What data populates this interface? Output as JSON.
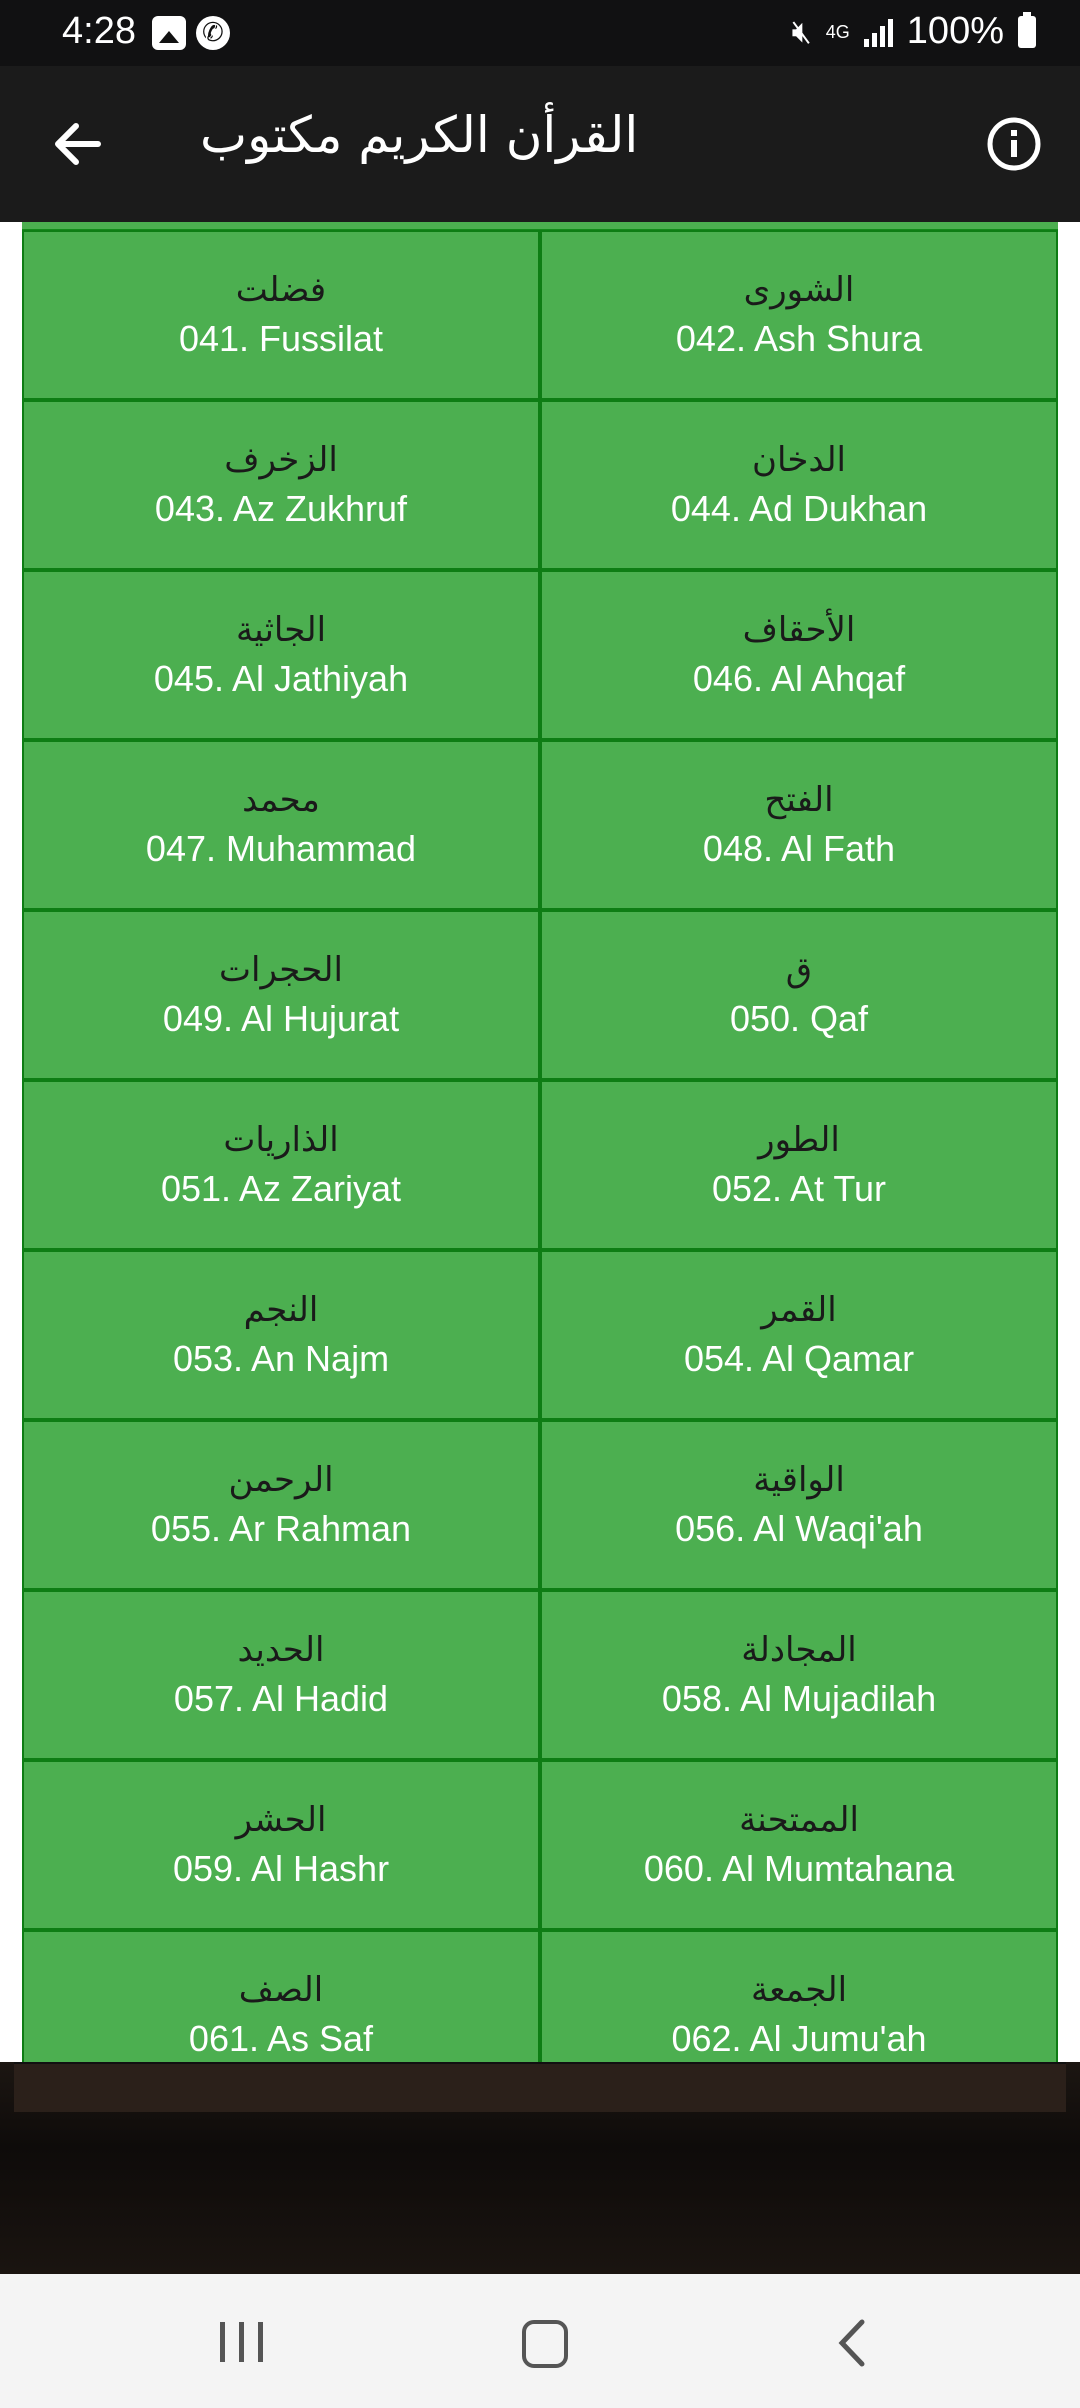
{
  "status_bar": {
    "time": "4:28",
    "network": "4G",
    "battery": "100%"
  },
  "app_bar": {
    "title": "القرأن الكريم مكتوب",
    "back_icon": "arrow-left-icon",
    "info_icon": "info-icon"
  },
  "surahs": [
    {
      "ar": "فضلت",
      "en": "041. Fussilat"
    },
    {
      "ar": "الشورى",
      "en": "042. Ash Shura"
    },
    {
      "ar": "الزخرف",
      "en": "043. Az Zukhruf"
    },
    {
      "ar": "الدخان",
      "en": "044. Ad Dukhan"
    },
    {
      "ar": "الجاثية",
      "en": "045. Al Jathiyah"
    },
    {
      "ar": "الأحقاف",
      "en": "046. Al Ahqaf"
    },
    {
      "ar": "محمد",
      "en": "047. Muhammad"
    },
    {
      "ar": "الفتح",
      "en": "048. Al Fath"
    },
    {
      "ar": "الحجرات",
      "en": "049. Al Hujurat"
    },
    {
      "ar": "ق",
      "en": "050. Qaf"
    },
    {
      "ar": "الذاريات",
      "en": "051. Az Zariyat"
    },
    {
      "ar": "الطور",
      "en": "052. At Tur"
    },
    {
      "ar": "النجم",
      "en": "053. An Najm"
    },
    {
      "ar": "القمر",
      "en": "054. Al Qamar"
    },
    {
      "ar": "الرحمن",
      "en": "055. Ar Rahman"
    },
    {
      "ar": "الواقية",
      "en": "056. Al Waqi'ah"
    },
    {
      "ar": "الحديد",
      "en": "057. Al Hadid"
    },
    {
      "ar": "المجادلة",
      "en": "058. Al Mujadilah"
    },
    {
      "ar": "الحشر",
      "en": "059. Al Hashr"
    },
    {
      "ar": "الممتحنة",
      "en": "060. Al Mumtahana"
    },
    {
      "ar": "الصف",
      "en": "061. As Saf"
    },
    {
      "ar": "الجمعة",
      "en": "062. Al Jumu'ah"
    }
  ],
  "colors": {
    "cell_bg": "#4caf50",
    "cell_border": "#0e7d14",
    "app_bar": "#1b1b1b",
    "status_bar": "#111112"
  },
  "nav_bar": {
    "recent_icon": "recent-apps-icon",
    "home_icon": "home-icon",
    "back_icon": "back-chevron-icon"
  }
}
